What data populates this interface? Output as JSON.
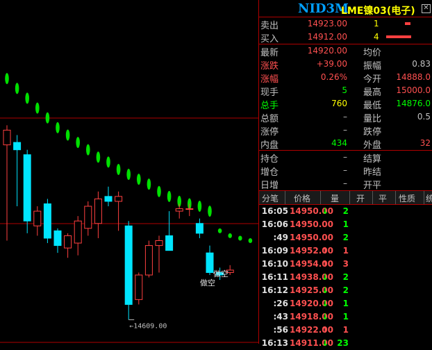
{
  "colors": {
    "up": "#ff5050",
    "down": "#00ff00",
    "accent": "#00a0ff",
    "grid": "#b00000"
  },
  "header": {
    "code": "NID3M",
    "name": "LME镍03(电子)",
    "close_icon": "close-icon"
  },
  "orderbook": {
    "sell": {
      "label": "卖出",
      "price": "14923.00",
      "qty": "1"
    },
    "buy": {
      "label": "买入",
      "price": "14912.00",
      "qty": "4"
    }
  },
  "quote": {
    "latest": {
      "label": "最新",
      "value": "14920.00"
    },
    "avg": {
      "label": "均价",
      "value": ""
    },
    "change": {
      "label": "涨跌",
      "value": "+39.00"
    },
    "amplitude": {
      "label": "振幅",
      "value": "0.83"
    },
    "change_pct": {
      "label": "涨幅",
      "value": "0.26%"
    },
    "open": {
      "label": "今开",
      "value": "14888.0"
    },
    "last_vol": {
      "label": "现手",
      "value": "5"
    },
    "high": {
      "label": "最高",
      "value": "15000.0"
    },
    "total_vol": {
      "label": "总手",
      "value": "760"
    },
    "low": {
      "label": "最低",
      "value": "14876.0"
    },
    "turnover": {
      "label": "总额",
      "value": "–"
    },
    "vol_ratio": {
      "label": "量比",
      "value": "0.5"
    },
    "limit_up": {
      "label": "涨停",
      "value": "–"
    },
    "limit_down": {
      "label": "跌停",
      "value": ""
    },
    "inner": {
      "label": "内盘",
      "value": "434"
    },
    "outer": {
      "label": "外盘",
      "value": "32"
    },
    "open_int": {
      "label": "持仓",
      "value": "–"
    },
    "settle": {
      "label": "结算",
      "value": ""
    },
    "oi_change": {
      "label": "增仓",
      "value": "–"
    },
    "prev_settle": {
      "label": "昨结",
      "value": ""
    },
    "daily_add": {
      "label": "日增",
      "value": "–"
    },
    "open_flat": {
      "label": "开平",
      "value": ""
    }
  },
  "ticks": {
    "headers": [
      "分笔",
      "价格",
      "量",
      "开",
      "平",
      "性质",
      "统"
    ],
    "rows": [
      {
        "time": "16:05",
        "price": "14950.00",
        "dir": "down",
        "qty": "2"
      },
      {
        "time": "16:06",
        "price": "14950.00",
        "dir": "",
        "qty": "1"
      },
      {
        "time": ":49",
        "price": "14950.00",
        "dir": "",
        "qty": "2"
      },
      {
        "time": "16:09",
        "price": "14952.00",
        "dir": "up",
        "qty": "1"
      },
      {
        "time": "16:10",
        "price": "14954.00",
        "dir": "up",
        "qty": "3"
      },
      {
        "time": "16:11",
        "price": "14938.00",
        "dir": "down",
        "qty": "2"
      },
      {
        "time": "16:12",
        "price": "14925.00",
        "dir": "down",
        "qty": "2"
      },
      {
        "time": ":26",
        "price": "14920.00",
        "dir": "down",
        "qty": "1"
      },
      {
        "time": ":43",
        "price": "14918.00",
        "dir": "down",
        "qty": "1"
      },
      {
        "time": ":56",
        "price": "14922.00",
        "dir": "up",
        "qty": "1"
      },
      {
        "time": "16:13",
        "price": "14911.00",
        "dir": "down",
        "qty": "23"
      }
    ]
  },
  "chart_data": {
    "type": "candlestick",
    "low_label": "←14609.00",
    "annotations": [
      "做空",
      "做空"
    ],
    "candles": [
      {
        "o": 14965,
        "c": 14995,
        "h": 15005,
        "l": 14770
      },
      {
        "o": 14970,
        "c": 14955,
        "h": 14985,
        "l": 14840
      },
      {
        "o": 14945,
        "c": 14810,
        "h": 14955,
        "l": 14785
      },
      {
        "o": 14800,
        "c": 14830,
        "h": 14840,
        "l": 14780
      },
      {
        "o": 14845,
        "c": 14775,
        "h": 14855,
        "l": 14765
      },
      {
        "o": 14790,
        "c": 14760,
        "h": 14795,
        "l": 14745
      },
      {
        "o": 14755,
        "c": 14780,
        "h": 14785,
        "l": 14735
      },
      {
        "o": 14765,
        "c": 14810,
        "h": 14820,
        "l": 14740
      },
      {
        "o": 14795,
        "c": 14840,
        "h": 14850,
        "l": 14780
      },
      {
        "o": 14805,
        "c": 14855,
        "h": 14870,
        "l": 14775
      },
      {
        "o": 14860,
        "c": 14850,
        "h": 14880,
        "l": 14840
      },
      {
        "o": 14850,
        "c": 14860,
        "h": 14870,
        "l": 14790
      },
      {
        "o": 14800,
        "c": 14640,
        "h": 14810,
        "l": 14609
      },
      {
        "o": 14650,
        "c": 14700,
        "h": 14705,
        "l": 14640
      },
      {
        "o": 14700,
        "c": 14760,
        "h": 14770,
        "l": 14695
      },
      {
        "o": 14760,
        "c": 14770,
        "h": 14780,
        "l": 14705
      },
      {
        "o": 14780,
        "c": 14750,
        "h": 14830,
        "l": 14750
      },
      {
        "o": 14830,
        "c": 14835,
        "h": 14845,
        "l": 14815
      },
      {
        "o": 14835,
        "c": 14835,
        "h": 14845,
        "l": 14820
      },
      {
        "o": 14805,
        "c": 14785,
        "h": 14815,
        "l": 14775
      },
      {
        "o": 14745,
        "c": 14705,
        "h": 14760,
        "l": 14700
      },
      {
        "o": 14705,
        "c": 14700,
        "h": 14715,
        "l": 14690
      },
      {
        "o": 14705,
        "c": 14710,
        "h": 14720,
        "l": 14700
      }
    ],
    "stop_dots": [
      15100,
      15080,
      15060,
      15040,
      15020,
      15000,
      14985,
      14970,
      14955,
      14940,
      14930,
      14915,
      14905,
      14895,
      14885,
      14870,
      14860,
      14850,
      14845,
      14840,
      14830,
      14790,
      14780,
      14775,
      14770
    ],
    "ylim": [
      14560,
      15260
    ]
  }
}
